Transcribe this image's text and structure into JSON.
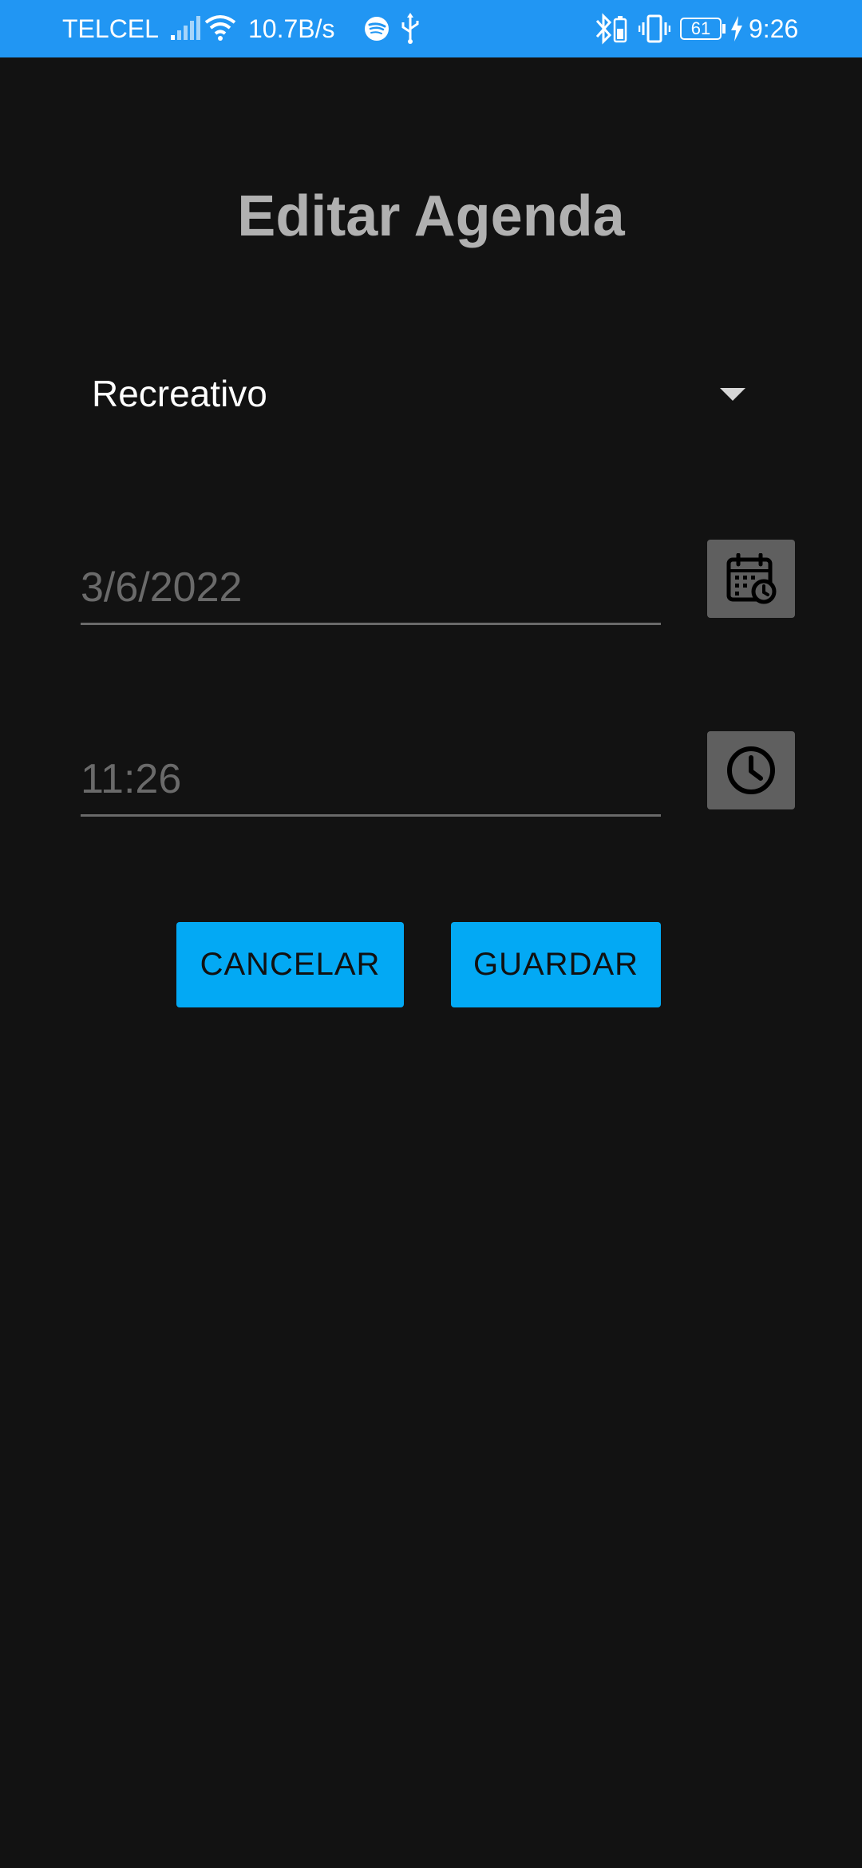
{
  "status_bar": {
    "carrier": "TELCEL",
    "net_speed": "10.7B/s",
    "battery_level": "61",
    "time": "9:26",
    "icons": [
      "signal-icon",
      "wifi-icon",
      "spotify-icon",
      "usb-icon",
      "bluetooth-battery-icon",
      "vibrate-icon",
      "battery-icon",
      "charging-icon"
    ]
  },
  "screen": {
    "title": "Editar Agenda"
  },
  "category_spinner": {
    "selected": "Recreativo"
  },
  "date_field": {
    "value": "3/6/2022"
  },
  "time_field": {
    "value": "11:26"
  },
  "actions": {
    "cancel_label": "CANCELAR",
    "save_label": "GUARDAR"
  },
  "colors": {
    "status_bar": "#2196F3",
    "background": "#121212",
    "title": "#B0B0B0",
    "button": "#03A9F4",
    "icon_button": "#5F5F5F"
  }
}
